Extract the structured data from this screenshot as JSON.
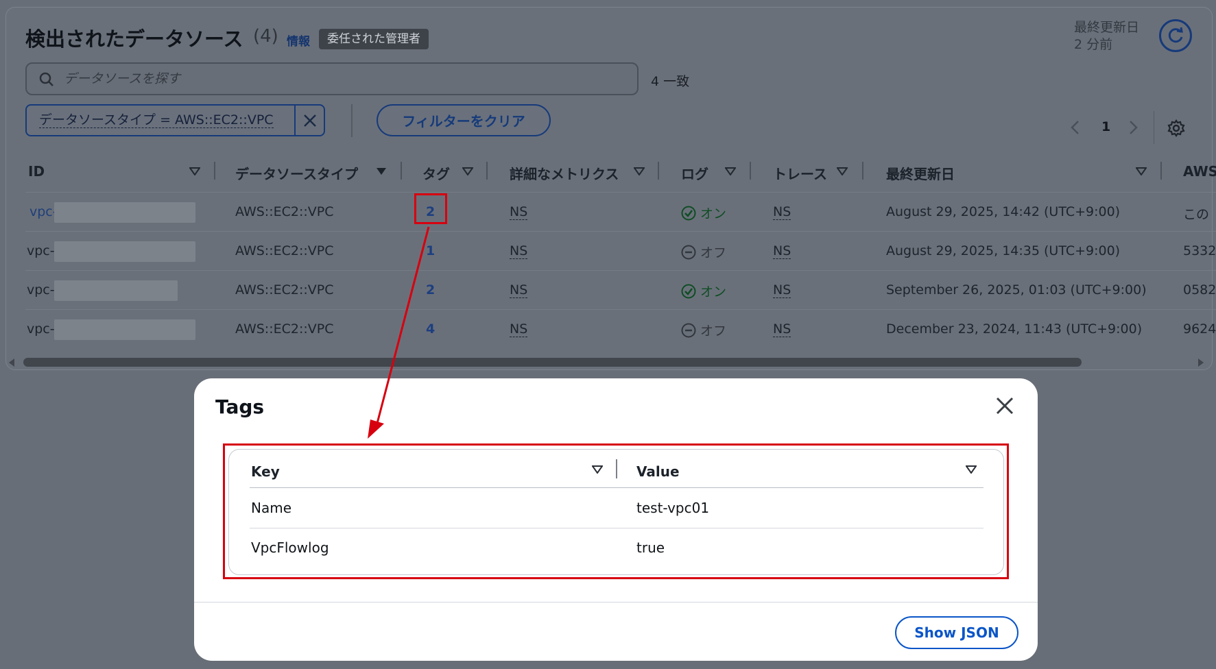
{
  "header": {
    "title": "検出されたデータソース",
    "count": "(4)",
    "info_link": "情報",
    "badge": "委任された管理者",
    "last_updated_label": "最終更新日",
    "last_updated_value": "2 分前"
  },
  "search": {
    "placeholder": "データソースを探す",
    "match_count": "4 一致"
  },
  "filter": {
    "token_label": "データソースタイプ = AWS::EC2::VPC",
    "clear_button": "フィルターをクリア"
  },
  "pagination": {
    "current_page": "1"
  },
  "table": {
    "columns": [
      "ID",
      "データソースタイプ",
      "タグ",
      "詳細なメトリクス",
      "ログ",
      "トレース",
      "最終更新日",
      "AWS"
    ],
    "rows": [
      {
        "id": "vpc-",
        "type": "AWS::EC2::VPC",
        "tags": "2",
        "metrics": "NS",
        "log": "オン",
        "log_state": "on",
        "trace": "NS",
        "updated": "August 29, 2025, 14:42 (UTC+9:00)",
        "aws": "この"
      },
      {
        "id": "vpc-",
        "type": "AWS::EC2::VPC",
        "tags": "1",
        "metrics": "NS",
        "log": "オフ",
        "log_state": "off",
        "trace": "NS",
        "updated": "August 29, 2025, 14:35 (UTC+9:00)",
        "aws": "5332"
      },
      {
        "id": "vpc-",
        "type": "AWS::EC2::VPC",
        "tags": "2",
        "metrics": "NS",
        "log": "オン",
        "log_state": "on",
        "trace": "NS",
        "updated": "September 26, 2025, 01:03 (UTC+9:00)",
        "aws": "0582"
      },
      {
        "id": "vpc-",
        "type": "AWS::EC2::VPC",
        "tags": "4",
        "metrics": "NS",
        "log": "オフ",
        "log_state": "off",
        "trace": "NS",
        "updated": "December 23, 2024, 11:43 (UTC+9:00)",
        "aws": "9624"
      }
    ]
  },
  "modal": {
    "title": "Tags",
    "columns": [
      "Key",
      "Value"
    ],
    "rows": [
      {
        "key": "Name",
        "value": "test-vpc01"
      },
      {
        "key": "VpcFlowlog",
        "value": "true"
      }
    ],
    "show_json_button": "Show JSON"
  },
  "colors": {
    "highlight": "#d7000f",
    "link": "#1e3f7a",
    "primary_button": "#0a55c8",
    "overlay": "#686e78"
  }
}
